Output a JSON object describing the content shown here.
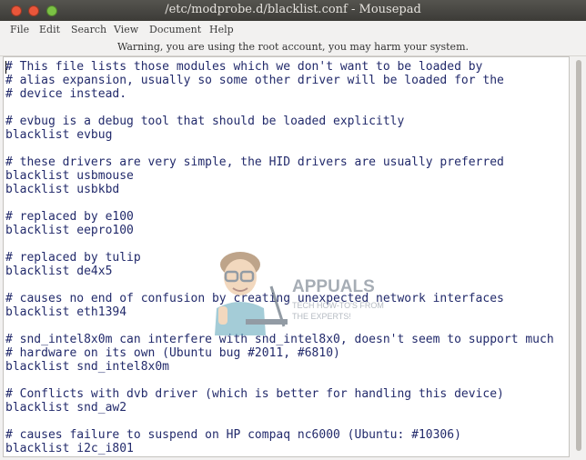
{
  "window": {
    "title": "/etc/modprobe.d/blacklist.conf - Mousepad"
  },
  "menu": {
    "items": [
      "File",
      "Edit",
      "Search",
      "View",
      "Document",
      "Help"
    ]
  },
  "infobar": {
    "text": "Warning, you are using the root account, you may harm your system."
  },
  "editor": {
    "lines": [
      "# This file lists those modules which we don't want to be loaded by",
      "# alias expansion, usually so some other driver will be loaded for the",
      "# device instead.",
      "",
      "# evbug is a debug tool that should be loaded explicitly",
      "blacklist evbug",
      "",
      "# these drivers are very simple, the HID drivers are usually preferred",
      "blacklist usbmouse",
      "blacklist usbkbd",
      "",
      "# replaced by e100",
      "blacklist eepro100",
      "",
      "# replaced by tulip",
      "blacklist de4x5",
      "",
      "# causes no end of confusion by creating unexpected network interfaces",
      "blacklist eth1394",
      "",
      "# snd_intel8x0m can interfere with snd_intel8x0, doesn't seem to support much",
      "# hardware on its own (Ubuntu bug #2011, #6810)",
      "blacklist snd_intel8x0m",
      "",
      "# Conflicts with dvb driver (which is better for handling this device)",
      "blacklist snd_aw2",
      "",
      "# causes failure to suspend on HP compaq nc6000 (Ubuntu: #10306)",
      "blacklist i2c_i801"
    ]
  },
  "watermark": {
    "brand": "APPUALS",
    "tagline_1": "TECH HOW-TO'S FROM",
    "tagline_2": "THE EXPERTS!"
  }
}
